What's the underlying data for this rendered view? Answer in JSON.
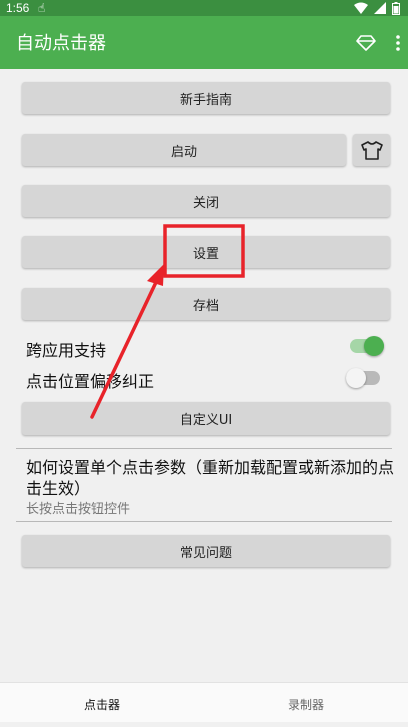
{
  "status_bar": {
    "time": "1:56"
  },
  "app_bar": {
    "title": "自动点击器"
  },
  "buttons": {
    "guide": "新手指南",
    "start": "启动",
    "close": "关闭",
    "settings": "设置",
    "archive": "存档",
    "customize_ui": "自定义UI",
    "faq": "常见问题"
  },
  "toggles": [
    {
      "label": "跨应用支持",
      "on": true
    },
    {
      "label": "点击位置偏移纠正",
      "on": false
    }
  ],
  "tip": {
    "title": "如何设置单个点击参数（重新加载配置或新添加的点击生效）",
    "subtitle": "长按点击按钮控件"
  },
  "bottom_nav": [
    {
      "label": "点击器",
      "active": true
    },
    {
      "label": "录制器",
      "active": false
    }
  ],
  "colors": {
    "status_bar": "#3b8f40",
    "app_bar": "#4caf50",
    "switch_on_thumb": "#4caf50",
    "switch_on_track": "#a5d6a7",
    "annotation": "#e8232a"
  }
}
